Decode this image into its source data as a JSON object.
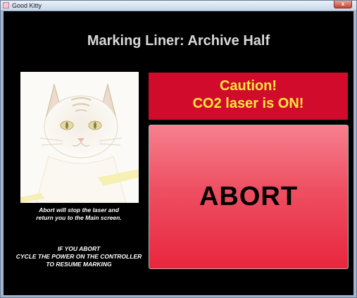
{
  "window": {
    "title": "Good Kitty",
    "close_glyph": "x"
  },
  "screen": {
    "title": "Marking Liner: Archive Half"
  },
  "image": {
    "icon": "cat-photo"
  },
  "notes": {
    "abort_line1": "Abort will stop the laser and",
    "abort_line2": "return you to the Main screen.",
    "power_line1": "IF YOU ABORT",
    "power_line2": "CYCLE THE POWER ON THE CONTROLLER",
    "power_line3": "TO RESUME MARKING"
  },
  "caution": {
    "line1": "Caution!",
    "line2": "CO2 laser is ON!",
    "background_color": "#d10b2b",
    "text_color": "#ffe840"
  },
  "abort_button": {
    "label": "ABORT",
    "color": "#e8263d"
  }
}
